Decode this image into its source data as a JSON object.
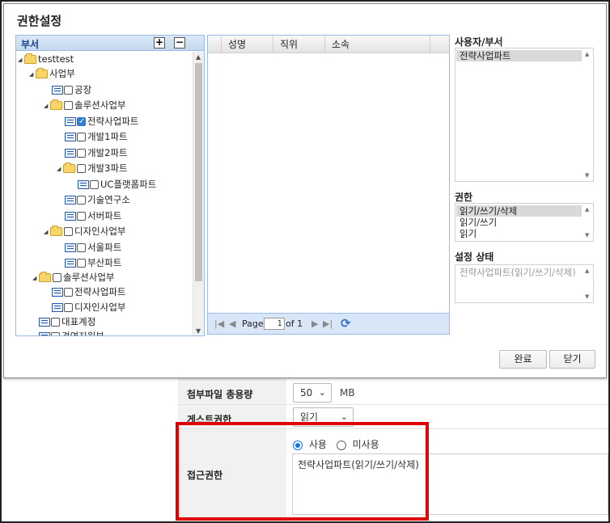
{
  "dialog": {
    "title": "권한설정",
    "dept_tree": {
      "title": "부서",
      "expand_button": "+",
      "collapse_button": "−",
      "nodes": [
        {
          "label": "testtest",
          "type": "folder",
          "tri": "◢",
          "checkbox": false,
          "checked": false
        },
        {
          "label": "사업부",
          "type": "folder",
          "tri": "◢",
          "checkbox": false,
          "checked": false
        },
        {
          "label": "공장",
          "type": "leaf",
          "tri": "",
          "checkbox": true,
          "checked": false
        },
        {
          "label": "솔루션사업부",
          "type": "folder",
          "tri": "◢",
          "checkbox": true,
          "checked": false
        },
        {
          "label": "전략사업파트",
          "type": "leaf",
          "tri": "",
          "checkbox": true,
          "checked": true
        },
        {
          "label": "개발1파트",
          "type": "leaf",
          "tri": "",
          "checkbox": true,
          "checked": false
        },
        {
          "label": "개발2파트",
          "type": "leaf",
          "tri": "",
          "checkbox": true,
          "checked": false
        },
        {
          "label": "개발3파트",
          "type": "folder",
          "tri": "◢",
          "checkbox": true,
          "checked": false
        },
        {
          "label": "UC플랫폼파트",
          "type": "leaf",
          "tri": "",
          "checkbox": true,
          "checked": false
        },
        {
          "label": "기술연구소",
          "type": "leaf",
          "tri": "",
          "checkbox": true,
          "checked": false
        },
        {
          "label": "서버파트",
          "type": "leaf",
          "tri": "",
          "checkbox": true,
          "checked": false
        },
        {
          "label": "디자인사업부",
          "type": "folder",
          "tri": "◢",
          "checkbox": true,
          "checked": false
        },
        {
          "label": "서울파트",
          "type": "leaf",
          "tri": "",
          "checkbox": true,
          "checked": false
        },
        {
          "label": "부산파트",
          "type": "leaf",
          "tri": "",
          "checkbox": true,
          "checked": false
        },
        {
          "label": "솔루션사업부",
          "type": "folder",
          "tri": "◢",
          "checkbox": true,
          "checked": false
        },
        {
          "label": "전략사업파트",
          "type": "leaf",
          "tri": "",
          "checkbox": true,
          "checked": false
        },
        {
          "label": "디자인사업부",
          "type": "leaf",
          "tri": "",
          "checkbox": true,
          "checked": false
        },
        {
          "label": "대표계정",
          "type": "leaf",
          "tri": "",
          "checkbox": true,
          "checked": false
        },
        {
          "label": "경영지원부",
          "type": "leaf",
          "tri": "",
          "checkbox": true,
          "checked": false
        }
      ]
    },
    "user_grid": {
      "columns": [
        "성명",
        "직위",
        "소속"
      ],
      "pager": {
        "page_label": "Page",
        "page_value": "1",
        "of_label": "of 1"
      }
    },
    "user_dept": {
      "label": "사용자/부서",
      "items": [
        "전략사업파트"
      ]
    },
    "permission": {
      "label": "권한",
      "items": [
        "읽기/쓰기/삭제",
        "읽기/쓰기",
        "읽기"
      ],
      "selected": "읽기/쓰기/삭제"
    },
    "status": {
      "label": "설정 상태",
      "items": [
        "전략사업파트(읽기/쓰기/삭제)"
      ]
    },
    "buttons": {
      "ok": "완료",
      "close": "닫기"
    }
  },
  "form": {
    "attachment": {
      "label": "첨부파일 총용량",
      "value": "50",
      "unit": "MB"
    },
    "guest": {
      "label": "게스트권한",
      "value": "읽기"
    },
    "access": {
      "label": "접근권한",
      "radio_use": "사용",
      "radio_unuse": "미사용",
      "selected": "사용",
      "value": "전략사업파트(읽기/쓰기/삭제)"
    }
  },
  "colors": {
    "highlight_border": "#e00000",
    "tree_header": "#c8d9ef",
    "accent": "#1a73e8"
  }
}
